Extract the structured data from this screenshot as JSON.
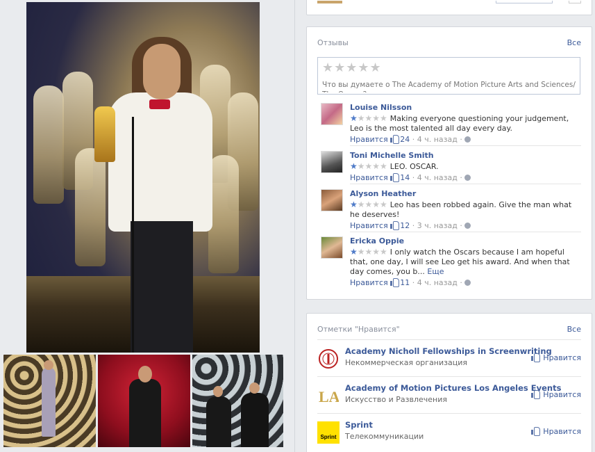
{
  "reviews": {
    "title": "Отзывы",
    "all_label": "Все",
    "stars": "★★★★★",
    "prompt": "Что вы думаете о The Academy of Motion Picture Arts and Sciences/ The Oscars?",
    "comments": [
      {
        "name": "Louise Nilsson",
        "text": "Making everyone questioning your judgement, Leo is the most talented all day every day.",
        "like": "Нравится",
        "count": "24",
        "time": "4 ч. назад",
        "rating": 1
      },
      {
        "name": "Toni Michelle Smith",
        "text": "LEO. OSCAR.",
        "like": "Нравится",
        "count": "14",
        "time": "4 ч. назад",
        "rating": 1
      },
      {
        "name": "Alyson Heather",
        "text": "Leo has been robbed again. Give the man what he deserves!",
        "like": "Нравится",
        "count": "12",
        "time": "3 ч. назад",
        "rating": 1
      },
      {
        "name": "Ericka Oppie",
        "text": "I only watch the Oscars because I am hopeful that, one day, I will see Leo get his award. And when that day comes, you b...",
        "more": "Еще",
        "like": "Нравится",
        "count": "11",
        "time": "4 ч. назад",
        "rating": 1
      }
    ]
  },
  "likes": {
    "title": "Отметки \"Нравится\"",
    "all_label": "Все",
    "pages": [
      {
        "name": "Academy Nicholl Fellowships in Screenwriting",
        "category": "Некоммерческая организация",
        "like": "Нравится",
        "icon": "academy-seal-icon"
      },
      {
        "name": "Academy of Motion Pictures Los Angeles Events",
        "category": "Искусство и Развлечения",
        "like": "Нравится",
        "icon": "la-logo-icon"
      },
      {
        "name": "Sprint",
        "category": "Телекоммуникации",
        "like": "Нравится",
        "icon": "sprint-logo-icon",
        "logo_text": "Sprint"
      }
    ]
  },
  "colors": {
    "link": "#3b5998",
    "star_on": "#4f7bc8",
    "star_off": "#c8c8c8",
    "sprint_yellow": "#ffe100"
  }
}
